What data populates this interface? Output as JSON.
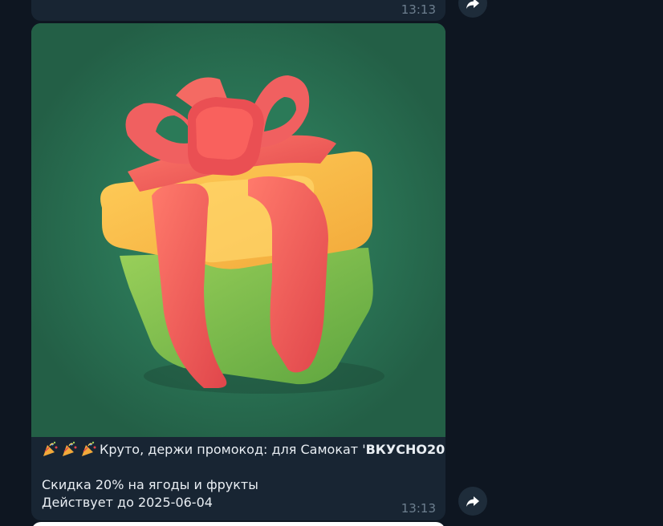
{
  "messages": [
    {
      "time": "13:13"
    },
    {
      "caption_line1_prefix": "Круто, держи промокод: для Самокат '",
      "promo_code": "ВКУСНО20",
      "caption_line1_suffix": "'",
      "caption_line2": "Скидка 20% на ягоды и фрукты",
      "caption_line3": "Действует до 2025-06-04",
      "time": "13:13",
      "emojis": [
        "party-popper-icon",
        "party-popper-icon",
        "party-popper-icon"
      ]
    }
  ],
  "colors": {
    "chat_background": "#0e1621",
    "bubble": "#182533",
    "image_background": "#2a7a58",
    "time_text": "#6d7f8f"
  }
}
